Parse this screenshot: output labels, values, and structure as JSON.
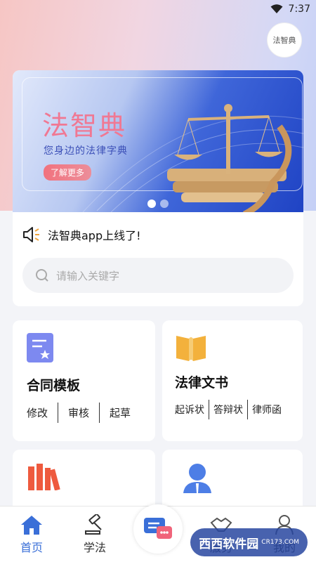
{
  "status_bar": {
    "time": "7:37"
  },
  "header": {
    "logo_text": "法智典"
  },
  "banner": {
    "title": "法智典",
    "subtitle": "您身边的法律字典",
    "button_label": "了解更多",
    "active_dot": 1,
    "dot_count": 2
  },
  "notice": {
    "text": "法智典app上线了!"
  },
  "search": {
    "placeholder": "请输入关键字"
  },
  "cards": {
    "contract": {
      "title": "合同模板",
      "actions": [
        "修改",
        "审核",
        "起草"
      ]
    },
    "documents": {
      "title": "法律文书",
      "actions": [
        "起诉状",
        "答辩状",
        "律师函"
      ]
    }
  },
  "tab_bar": {
    "items": [
      {
        "label": "首页",
        "icon": "home-icon",
        "active": true
      },
      {
        "label": "学法",
        "icon": "gavel-icon",
        "active": false
      },
      {
        "label": "",
        "icon": "chat-icon",
        "active": false
      },
      {
        "label": "服务",
        "icon": "handshake-icon",
        "active": false
      },
      {
        "label": "我的",
        "icon": "user-icon",
        "active": false
      }
    ]
  },
  "watermark": {
    "text": "西西软件园",
    "sub": "CR173.COM"
  },
  "colors": {
    "accent": "#3a6fd8",
    "banner_pink": "#f07893"
  }
}
